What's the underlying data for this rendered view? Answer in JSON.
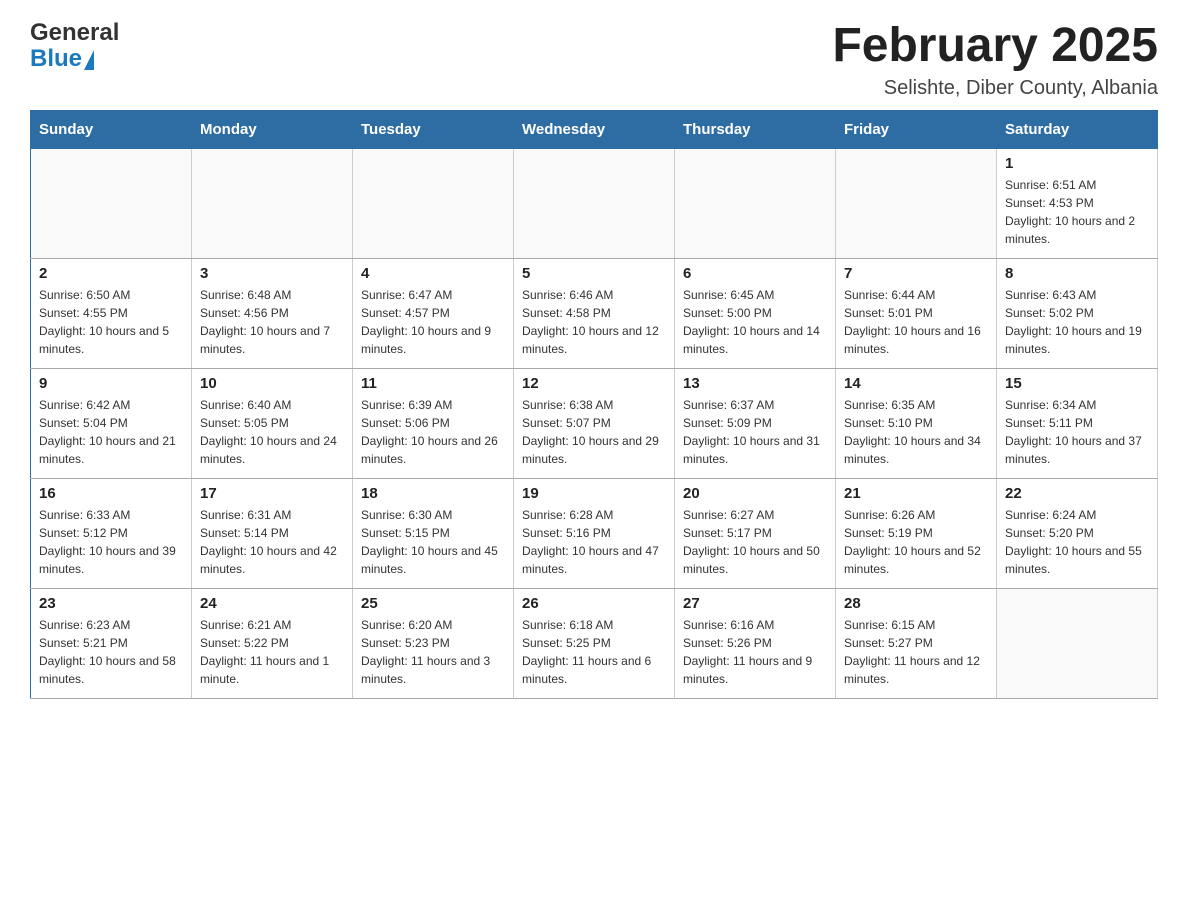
{
  "header": {
    "logo_general": "General",
    "logo_blue": "Blue",
    "month_title": "February 2025",
    "location": "Selishte, Diber County, Albania"
  },
  "weekdays": [
    "Sunday",
    "Monday",
    "Tuesday",
    "Wednesday",
    "Thursday",
    "Friday",
    "Saturday"
  ],
  "weeks": [
    [
      {
        "day": "",
        "info": ""
      },
      {
        "day": "",
        "info": ""
      },
      {
        "day": "",
        "info": ""
      },
      {
        "day": "",
        "info": ""
      },
      {
        "day": "",
        "info": ""
      },
      {
        "day": "",
        "info": ""
      },
      {
        "day": "1",
        "info": "Sunrise: 6:51 AM\nSunset: 4:53 PM\nDaylight: 10 hours and 2 minutes."
      }
    ],
    [
      {
        "day": "2",
        "info": "Sunrise: 6:50 AM\nSunset: 4:55 PM\nDaylight: 10 hours and 5 minutes."
      },
      {
        "day": "3",
        "info": "Sunrise: 6:48 AM\nSunset: 4:56 PM\nDaylight: 10 hours and 7 minutes."
      },
      {
        "day": "4",
        "info": "Sunrise: 6:47 AM\nSunset: 4:57 PM\nDaylight: 10 hours and 9 minutes."
      },
      {
        "day": "5",
        "info": "Sunrise: 6:46 AM\nSunset: 4:58 PM\nDaylight: 10 hours and 12 minutes."
      },
      {
        "day": "6",
        "info": "Sunrise: 6:45 AM\nSunset: 5:00 PM\nDaylight: 10 hours and 14 minutes."
      },
      {
        "day": "7",
        "info": "Sunrise: 6:44 AM\nSunset: 5:01 PM\nDaylight: 10 hours and 16 minutes."
      },
      {
        "day": "8",
        "info": "Sunrise: 6:43 AM\nSunset: 5:02 PM\nDaylight: 10 hours and 19 minutes."
      }
    ],
    [
      {
        "day": "9",
        "info": "Sunrise: 6:42 AM\nSunset: 5:04 PM\nDaylight: 10 hours and 21 minutes."
      },
      {
        "day": "10",
        "info": "Sunrise: 6:40 AM\nSunset: 5:05 PM\nDaylight: 10 hours and 24 minutes."
      },
      {
        "day": "11",
        "info": "Sunrise: 6:39 AM\nSunset: 5:06 PM\nDaylight: 10 hours and 26 minutes."
      },
      {
        "day": "12",
        "info": "Sunrise: 6:38 AM\nSunset: 5:07 PM\nDaylight: 10 hours and 29 minutes."
      },
      {
        "day": "13",
        "info": "Sunrise: 6:37 AM\nSunset: 5:09 PM\nDaylight: 10 hours and 31 minutes."
      },
      {
        "day": "14",
        "info": "Sunrise: 6:35 AM\nSunset: 5:10 PM\nDaylight: 10 hours and 34 minutes."
      },
      {
        "day": "15",
        "info": "Sunrise: 6:34 AM\nSunset: 5:11 PM\nDaylight: 10 hours and 37 minutes."
      }
    ],
    [
      {
        "day": "16",
        "info": "Sunrise: 6:33 AM\nSunset: 5:12 PM\nDaylight: 10 hours and 39 minutes."
      },
      {
        "day": "17",
        "info": "Sunrise: 6:31 AM\nSunset: 5:14 PM\nDaylight: 10 hours and 42 minutes."
      },
      {
        "day": "18",
        "info": "Sunrise: 6:30 AM\nSunset: 5:15 PM\nDaylight: 10 hours and 45 minutes."
      },
      {
        "day": "19",
        "info": "Sunrise: 6:28 AM\nSunset: 5:16 PM\nDaylight: 10 hours and 47 minutes."
      },
      {
        "day": "20",
        "info": "Sunrise: 6:27 AM\nSunset: 5:17 PM\nDaylight: 10 hours and 50 minutes."
      },
      {
        "day": "21",
        "info": "Sunrise: 6:26 AM\nSunset: 5:19 PM\nDaylight: 10 hours and 52 minutes."
      },
      {
        "day": "22",
        "info": "Sunrise: 6:24 AM\nSunset: 5:20 PM\nDaylight: 10 hours and 55 minutes."
      }
    ],
    [
      {
        "day": "23",
        "info": "Sunrise: 6:23 AM\nSunset: 5:21 PM\nDaylight: 10 hours and 58 minutes."
      },
      {
        "day": "24",
        "info": "Sunrise: 6:21 AM\nSunset: 5:22 PM\nDaylight: 11 hours and 1 minute."
      },
      {
        "day": "25",
        "info": "Sunrise: 6:20 AM\nSunset: 5:23 PM\nDaylight: 11 hours and 3 minutes."
      },
      {
        "day": "26",
        "info": "Sunrise: 6:18 AM\nSunset: 5:25 PM\nDaylight: 11 hours and 6 minutes."
      },
      {
        "day": "27",
        "info": "Sunrise: 6:16 AM\nSunset: 5:26 PM\nDaylight: 11 hours and 9 minutes."
      },
      {
        "day": "28",
        "info": "Sunrise: 6:15 AM\nSunset: 5:27 PM\nDaylight: 11 hours and 12 minutes."
      },
      {
        "day": "",
        "info": ""
      }
    ]
  ]
}
